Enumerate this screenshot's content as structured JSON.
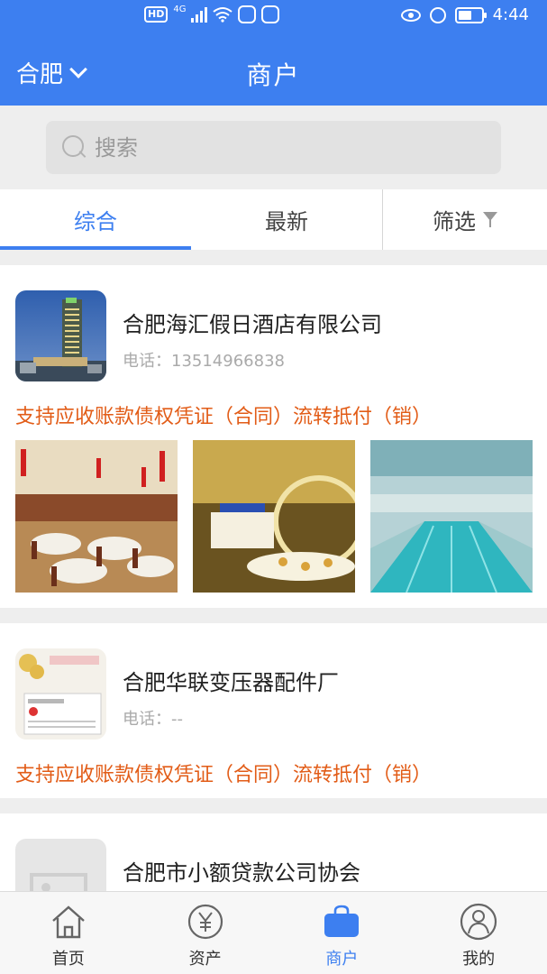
{
  "status_bar": {
    "hd_badge": "HD",
    "network": "4G",
    "time": "4:44"
  },
  "header": {
    "city": "合肥",
    "title": "商户"
  },
  "search": {
    "placeholder": "搜索"
  },
  "tabs": [
    {
      "label": "综合",
      "active": true
    },
    {
      "label": "最新",
      "active": false
    },
    {
      "label": "筛选",
      "active": false
    }
  ],
  "merchants": [
    {
      "name": "合肥海汇假日酒店有限公司",
      "phone_label": "电话：",
      "phone": "13514966838",
      "description": "支持应收账款债权凭证（合同）流转抵付（销）",
      "thumb_icon": "hotel-building-photo",
      "photos": [
        "restaurant-hall-photo",
        "buffet-photo",
        "swimming-pool-photo"
      ]
    },
    {
      "name": "合肥华联变压器配件厂",
      "phone_label": "电话：",
      "phone": "--",
      "description": "支持应收账款债权凭证（合同）流转抵付（销）",
      "thumb_icon": "certificate-document-photo",
      "photos": []
    },
    {
      "name": "合肥市小额贷款公司协会",
      "phone_label": "",
      "phone": "",
      "description": "",
      "thumb_icon": "image-placeholder-icon",
      "photos": []
    }
  ],
  "bottom_nav": [
    {
      "label": "首页",
      "icon": "home-icon",
      "active": false
    },
    {
      "label": "资产",
      "icon": "yen-coin-icon",
      "active": false
    },
    {
      "label": "商户",
      "icon": "shopping-bag-icon",
      "active": true
    },
    {
      "label": "我的",
      "icon": "user-icon",
      "active": false
    }
  ],
  "colors": {
    "primary": "#3d7ff0",
    "accent_text": "#e25c17",
    "background": "#eeeeee"
  }
}
